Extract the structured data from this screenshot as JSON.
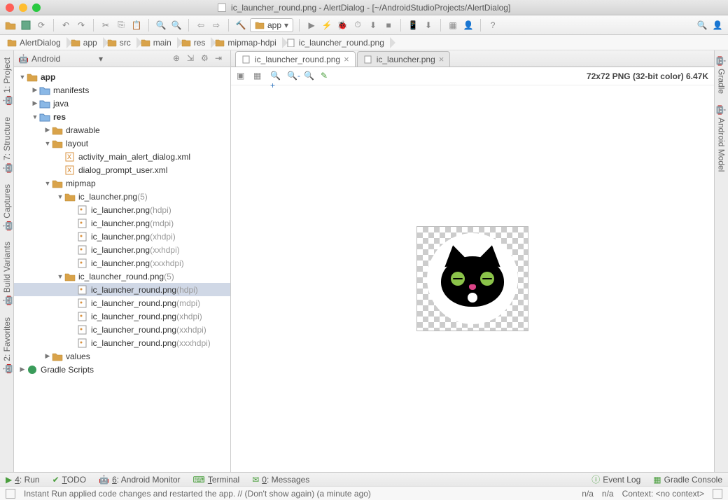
{
  "window": {
    "title_file": "ic_launcher_round.png",
    "title_project": "AlertDialog",
    "title_path": "[~/AndroidStudioProjects/AlertDialog]"
  },
  "toolbar": {
    "run_config": "app"
  },
  "breadcrumbs": [
    "AlertDialog",
    "app",
    "src",
    "main",
    "res",
    "mipmap-hdpi",
    "ic_launcher_round.png"
  ],
  "left_tools": [
    "1: Project",
    "7: Structure",
    "Captures",
    "Build Variants",
    "2: Favorites"
  ],
  "right_tools": [
    "Gradle",
    "Android Model"
  ],
  "project": {
    "view": "Android",
    "root": "app",
    "nodes": [
      {
        "d": 0,
        "exp": true,
        "type": "module",
        "label": "app",
        "bold": true
      },
      {
        "d": 1,
        "exp": false,
        "type": "folder",
        "label": "manifests"
      },
      {
        "d": 1,
        "exp": false,
        "type": "folder",
        "label": "java"
      },
      {
        "d": 1,
        "exp": true,
        "type": "folder",
        "label": "res",
        "bold": true
      },
      {
        "d": 2,
        "exp": false,
        "type": "resfolder",
        "label": "drawable"
      },
      {
        "d": 2,
        "exp": true,
        "type": "resfolder",
        "label": "layout"
      },
      {
        "d": 3,
        "exp": null,
        "type": "xml",
        "label": "activity_main_alert_dialog.xml"
      },
      {
        "d": 3,
        "exp": null,
        "type": "xml",
        "label": "dialog_prompt_user.xml"
      },
      {
        "d": 2,
        "exp": true,
        "type": "resfolder",
        "label": "mipmap"
      },
      {
        "d": 3,
        "exp": true,
        "type": "resgroup",
        "label": "ic_launcher.png",
        "suffix": "(5)"
      },
      {
        "d": 4,
        "exp": null,
        "type": "png",
        "label": "ic_launcher.png",
        "suffix": "(hdpi)"
      },
      {
        "d": 4,
        "exp": null,
        "type": "png",
        "label": "ic_launcher.png",
        "suffix": "(mdpi)"
      },
      {
        "d": 4,
        "exp": null,
        "type": "png",
        "label": "ic_launcher.png",
        "suffix": "(xhdpi)"
      },
      {
        "d": 4,
        "exp": null,
        "type": "png",
        "label": "ic_launcher.png",
        "suffix": "(xxhdpi)"
      },
      {
        "d": 4,
        "exp": null,
        "type": "png",
        "label": "ic_launcher.png",
        "suffix": "(xxxhdpi)"
      },
      {
        "d": 3,
        "exp": true,
        "type": "resgroup",
        "label": "ic_launcher_round.png",
        "suffix": "(5)"
      },
      {
        "d": 4,
        "exp": null,
        "type": "png",
        "label": "ic_launcher_round.png",
        "suffix": "(hdpi)",
        "selected": true
      },
      {
        "d": 4,
        "exp": null,
        "type": "png",
        "label": "ic_launcher_round.png",
        "suffix": "(mdpi)"
      },
      {
        "d": 4,
        "exp": null,
        "type": "png",
        "label": "ic_launcher_round.png",
        "suffix": "(xhdpi)"
      },
      {
        "d": 4,
        "exp": null,
        "type": "png",
        "label": "ic_launcher_round.png",
        "suffix": "(xxhdpi)"
      },
      {
        "d": 4,
        "exp": null,
        "type": "png",
        "label": "ic_launcher_round.png",
        "suffix": "(xxxhdpi)"
      },
      {
        "d": 2,
        "exp": false,
        "type": "resfolder",
        "label": "values"
      },
      {
        "d": 0,
        "exp": false,
        "type": "gradle",
        "label": "Gradle Scripts"
      }
    ]
  },
  "tabs": [
    {
      "label": "ic_launcher_round.png",
      "active": true
    },
    {
      "label": "ic_launcher.png",
      "active": false
    }
  ],
  "image_info": "72x72 PNG (32-bit color) 6.47K",
  "bottom_tools": [
    "4: Run",
    "TODO",
    "6: Android Monitor",
    "Terminal",
    "0: Messages"
  ],
  "bottom_right": [
    "Event Log",
    "Gradle Console"
  ],
  "status": {
    "msg": "Instant Run applied code changes and restarted the app. // (Don't show again) (a minute ago)",
    "right": [
      "n/a",
      "n/a",
      "Context: <no context>"
    ]
  }
}
